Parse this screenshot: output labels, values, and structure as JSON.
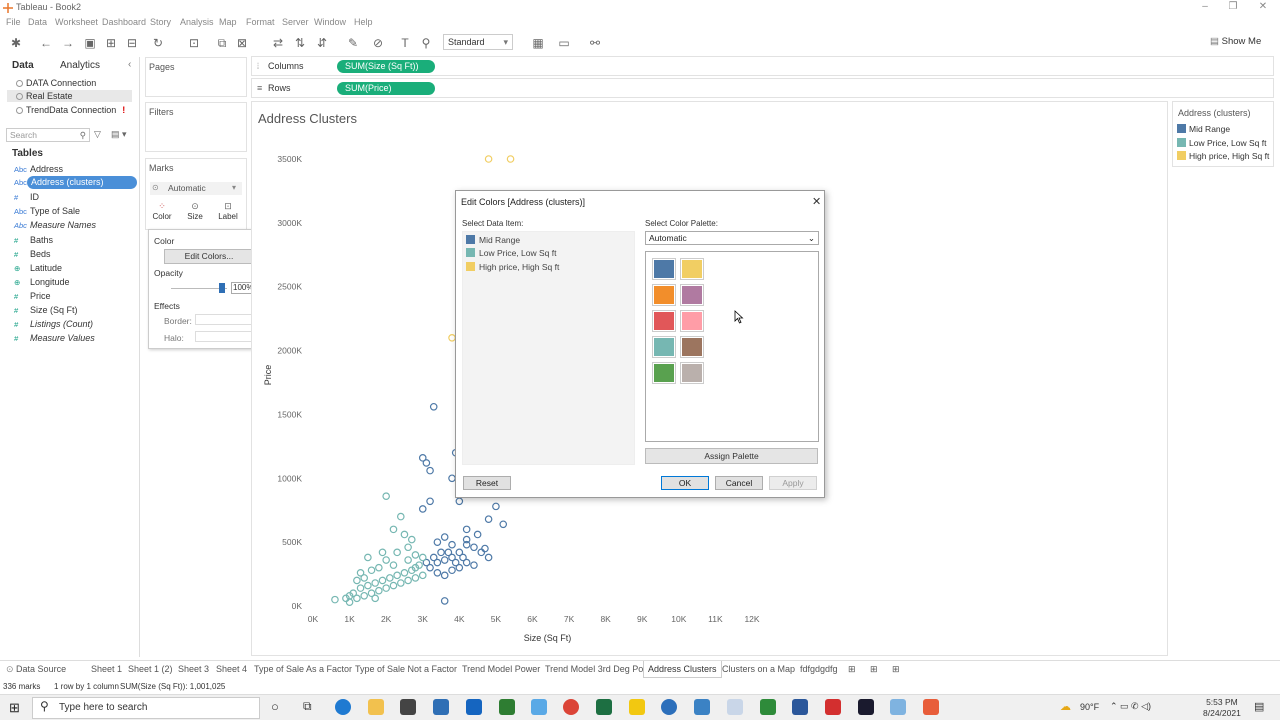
{
  "window": {
    "title": "Tableau - Book2"
  },
  "menu": [
    "File",
    "Data",
    "Worksheet",
    "Dashboard",
    "Story",
    "Analysis",
    "Map",
    "Format",
    "Server",
    "Window",
    "Help"
  ],
  "toolbar": {
    "fit_select": "Standard",
    "show_me": "Show Me"
  },
  "left_pane": {
    "tabs": [
      "Data",
      "Analytics"
    ],
    "connections": [
      "DATA Connection",
      "Real Estate",
      "TrendData Connection"
    ],
    "search_placeholder": "Search",
    "tables_header": "Tables",
    "fields": [
      {
        "type": "Abc",
        "name": "Address"
      },
      {
        "type": "Abc",
        "name": "Address (clusters)"
      },
      {
        "type": "#",
        "name": "ID"
      },
      {
        "type": "Abc",
        "name": "Type of Sale"
      },
      {
        "type": "Abc",
        "name": "Measure Names"
      },
      {
        "type": "#",
        "name": "Baths"
      },
      {
        "type": "#",
        "name": "Beds"
      },
      {
        "type": "⊕",
        "name": "Latitude"
      },
      {
        "type": "⊕",
        "name": "Longitude"
      },
      {
        "type": "#",
        "name": "Price"
      },
      {
        "type": "#",
        "name": "Size (Sq Ft)"
      },
      {
        "type": "#",
        "name": "Listings (Count)"
      },
      {
        "type": "#",
        "name": "Measure Values"
      }
    ]
  },
  "cards": {
    "pages": "Pages",
    "filters": "Filters",
    "marks": "Marks",
    "mark_type": "Automatic",
    "mark_buttons": [
      "Color",
      "Size",
      "Label"
    ]
  },
  "color_popup": {
    "color_label": "Color",
    "edit_colors": "Edit Colors...",
    "opacity_label": "Opacity",
    "opacity_value": "100%",
    "effects_label": "Effects",
    "border_label": "Border:",
    "halo_label": "Halo:"
  },
  "shelves": {
    "columns_label": "Columns",
    "columns_pill": "SUM(Size (Sq Ft))",
    "rows_label": "Rows",
    "rows_pill": "SUM(Price)"
  },
  "view": {
    "title": "Address Clusters"
  },
  "legend": {
    "title": "Address (clusters)",
    "items": [
      {
        "name": "Mid Range",
        "color": "#4e79a7"
      },
      {
        "name": "Low Price, Low Sq ft",
        "color": "#76b7b2"
      },
      {
        "name": "High price, High Sq ft",
        "color": "#f1ce63"
      }
    ]
  },
  "chart_data": {
    "type": "scatter",
    "title": "Address Clusters",
    "xlabel": "Size (Sq Ft)",
    "ylabel": "Price",
    "x_ticks": [
      "0K",
      "1K",
      "2K",
      "3K",
      "4K",
      "5K",
      "6K",
      "7K",
      "8K",
      "9K",
      "10K",
      "11K",
      "12K"
    ],
    "y_ticks": [
      "0K",
      "500K",
      "1000K",
      "1500K",
      "2000K",
      "2500K",
      "3000K",
      "3500K"
    ],
    "xlim": [
      0,
      12000
    ],
    "ylim": [
      0,
      3500000
    ],
    "series": [
      {
        "name": "High price, High Sq ft",
        "color": "#f1ce63",
        "points": [
          [
            4800,
            3500000
          ],
          [
            5400,
            3500000
          ],
          [
            3800,
            2100000
          ]
        ]
      },
      {
        "name": "Mid Range",
        "color": "#4e79a7",
        "points": [
          [
            3300,
            1560000
          ],
          [
            3000,
            1160000
          ],
          [
            3100,
            1120000
          ],
          [
            3200,
            1060000
          ],
          [
            3900,
            1200000
          ],
          [
            3800,
            1000000
          ],
          [
            3000,
            760000
          ],
          [
            3200,
            820000
          ],
          [
            4000,
            820000
          ],
          [
            4800,
            680000
          ],
          [
            5000,
            780000
          ],
          [
            5200,
            640000
          ],
          [
            4200,
            600000
          ],
          [
            3600,
            540000
          ],
          [
            3400,
            500000
          ],
          [
            3800,
            480000
          ],
          [
            4200,
            480000
          ],
          [
            4400,
            460000
          ],
          [
            4600,
            420000
          ],
          [
            4800,
            380000
          ],
          [
            4000,
            420000
          ],
          [
            3800,
            380000
          ],
          [
            3600,
            360000
          ],
          [
            3400,
            340000
          ],
          [
            3200,
            300000
          ],
          [
            3400,
            260000
          ],
          [
            3600,
            240000
          ],
          [
            3800,
            280000
          ],
          [
            4000,
            300000
          ],
          [
            4200,
            340000
          ],
          [
            4400,
            320000
          ],
          [
            4100,
            380000
          ],
          [
            3900,
            340000
          ],
          [
            3700,
            420000
          ],
          [
            3500,
            420000
          ],
          [
            3300,
            380000
          ],
          [
            3100,
            340000
          ],
          [
            4700,
            450000
          ],
          [
            4500,
            560000
          ],
          [
            3600,
            40000
          ],
          [
            4200,
            520000
          ]
        ]
      },
      {
        "name": "Low Price, Low Sq ft",
        "color": "#76b7b2",
        "points": [
          [
            2000,
            860000
          ],
          [
            2400,
            700000
          ],
          [
            2200,
            600000
          ],
          [
            2500,
            560000
          ],
          [
            2700,
            520000
          ],
          [
            2600,
            460000
          ],
          [
            2800,
            400000
          ],
          [
            3000,
            380000
          ],
          [
            2900,
            320000
          ],
          [
            2700,
            280000
          ],
          [
            2500,
            260000
          ],
          [
            2300,
            240000
          ],
          [
            2100,
            220000
          ],
          [
            1900,
            200000
          ],
          [
            1700,
            180000
          ],
          [
            1500,
            160000
          ],
          [
            1300,
            140000
          ],
          [
            1100,
            100000
          ],
          [
            1000,
            80000
          ],
          [
            900,
            60000
          ],
          [
            600,
            50000
          ],
          [
            1200,
            60000
          ],
          [
            1400,
            80000
          ],
          [
            1600,
            100000
          ],
          [
            1800,
            120000
          ],
          [
            2000,
            140000
          ],
          [
            2200,
            160000
          ],
          [
            2400,
            180000
          ],
          [
            2600,
            200000
          ],
          [
            2800,
            220000
          ],
          [
            3000,
            240000
          ],
          [
            2200,
            320000
          ],
          [
            2000,
            360000
          ],
          [
            1800,
            300000
          ],
          [
            1600,
            280000
          ],
          [
            1400,
            220000
          ],
          [
            1200,
            200000
          ],
          [
            1300,
            260000
          ],
          [
            2600,
            360000
          ],
          [
            2800,
            300000
          ],
          [
            1500,
            380000
          ],
          [
            1900,
            420000
          ],
          [
            2300,
            420000
          ],
          [
            1000,
            30000
          ],
          [
            1700,
            60000
          ]
        ]
      }
    ]
  },
  "dialog": {
    "title": "Edit Colors [Address (clusters)]",
    "select_item_label": "Select Data Item:",
    "select_palette_label": "Select Color Palette:",
    "palette_value": "Automatic",
    "items": [
      {
        "name": "Mid Range",
        "color": "#4e79a7"
      },
      {
        "name": "Low Price, Low Sq ft",
        "color": "#76b7b2"
      },
      {
        "name": "High price, High Sq ft",
        "color": "#f1ce63"
      }
    ],
    "palette_colors": [
      "#4e79a7",
      "#f1ce63",
      "#f28e2b",
      "#b07aa1",
      "#e15759",
      "#ff9da7",
      "#76b7b2",
      "#9c755f",
      "#59a14f",
      "#bab0ac"
    ],
    "assign_palette": "Assign Palette",
    "reset": "Reset",
    "ok": "OK",
    "cancel": "Cancel",
    "apply": "Apply"
  },
  "sheet_tabs": [
    "Data Source",
    "Sheet 1",
    "Sheet 1 (2)",
    "Sheet 3",
    "Sheet 4",
    "Type of Sale As a Factor",
    "Type of Sale Not a Factor",
    "Trend Model Power",
    "Trend Model 3rd Deg Pol",
    "Address Clusters",
    "Clusters on a Map",
    "fdfgdgdfg"
  ],
  "status": {
    "marks": "336 marks",
    "rows": "1 row by 1 column",
    "sum": "SUM(Size (Sq Ft)): 1,001,025"
  },
  "taskbar": {
    "search": "Type here to search",
    "temp": "90°F",
    "time": "5:53 PM",
    "date": "8/24/2021"
  }
}
